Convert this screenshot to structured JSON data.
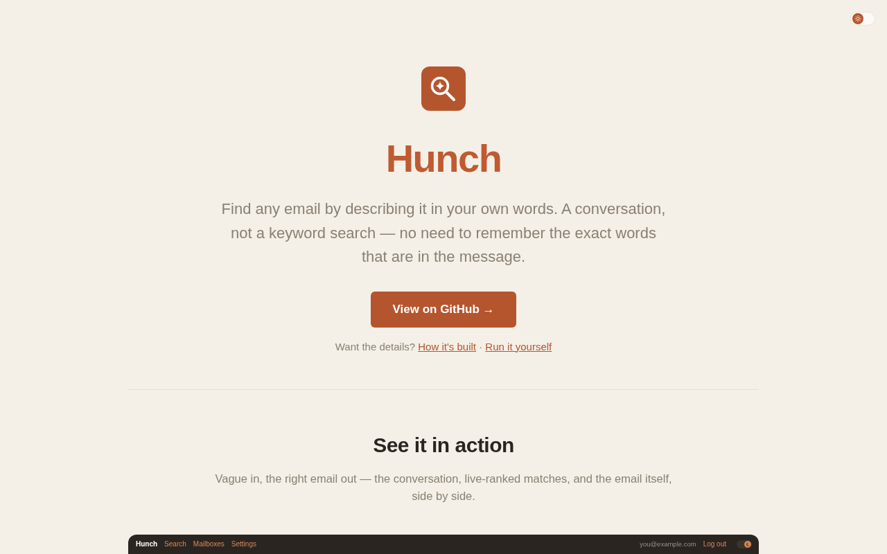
{
  "theme_toggle": {
    "dark": false
  },
  "hero": {
    "title": "Hunch",
    "tagline": "Find any email by describing it in your own words. A conversation, not a keyword search — no need to remember the exact words that are in the message.",
    "button": "View on GitHub →",
    "details": {
      "prompt": "Want the details?",
      "links": [
        "How it's built",
        "Run it yourself"
      ],
      "separator": "·"
    }
  },
  "demo": {
    "heading": "See it in action",
    "description": "Vague in, the right email out — the conversation, live-ranked matches, and the email itself, side by side.",
    "app": {
      "brand": "Hunch",
      "nav_links": [
        "Search",
        "Mailboxes",
        "Settings"
      ],
      "user": "you@example.com",
      "logout": "Log out",
      "theme_toggle": {
        "dark": true
      }
    }
  }
}
